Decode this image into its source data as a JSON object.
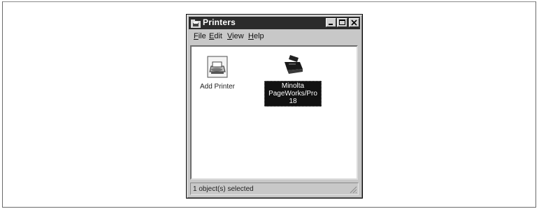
{
  "window": {
    "title": "Printers"
  },
  "menu": {
    "items": [
      {
        "underline": "F",
        "rest": "ile"
      },
      {
        "underline": "E",
        "rest": "dit"
      },
      {
        "underline": "V",
        "rest": "iew"
      },
      {
        "underline": "H",
        "rest": "elp"
      }
    ]
  },
  "items": [
    {
      "label": "Add Printer",
      "icon": "add-printer-icon",
      "selected": false
    },
    {
      "label": "Minolta PageWorks/Pro 18",
      "icon": "printer-icon",
      "selected": true
    }
  ],
  "status": {
    "text": "1 object(s) selected"
  },
  "colors": {
    "titlebar": "#2b2b2b",
    "window_face": "#c8c8c8",
    "selection": "#111111"
  }
}
